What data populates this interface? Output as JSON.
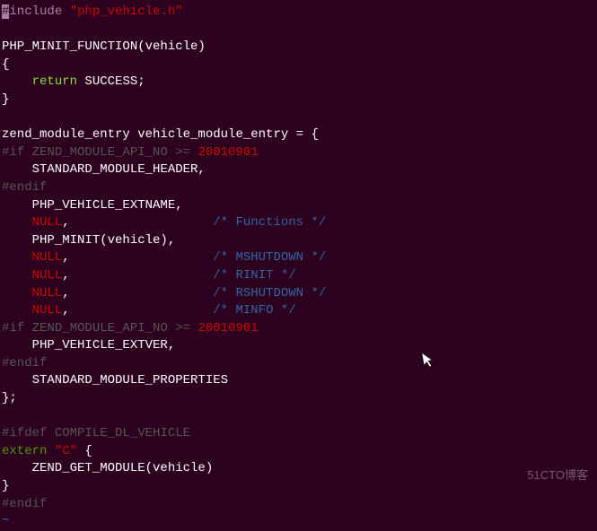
{
  "code": {
    "l1": {
      "hash": "#",
      "include": "include ",
      "file": "\"php_vehicle.h\""
    },
    "l2": "PHP_MINIT_FUNCTION(vehicle)",
    "l3": "{",
    "l4_indent": "    ",
    "l4_return": "return",
    "l4_rest": " SUCCESS;",
    "l5": "}",
    "l6": "zend_module_entry vehicle_module_entry = {",
    "l7_if": "#if",
    "l7_cond": " ZEND_MODULE_API_NO >= ",
    "l7_num": "20010901",
    "l8": "    STANDARD_MODULE_HEADER,",
    "l9": "#endif",
    "l10": "    PHP_VEHICLE_EXTNAME,",
    "l11_indent": "    ",
    "l11_null": "NULL",
    "l11_comma": ",",
    "l11_spaces": "                   ",
    "l11_comment": "/* Functions */",
    "l12": "    PHP_MINIT(vehicle),",
    "l13_null": "NULL",
    "l13_comment": "/* MSHUTDOWN */",
    "l14_null": "NULL",
    "l14_comment": "/* RINIT */",
    "l15_null": "NULL",
    "l15_comment": "/* RSHUTDOWN */",
    "l16_null": "NULL",
    "l16_comment": "/* MINFO */",
    "l17_if": "#if",
    "l17_cond": " ZEND_MODULE_API_NO >= ",
    "l17_num": "20010901",
    "l18": "    PHP_VEHICLE_EXTVER,",
    "l19": "#endif",
    "l20": "    STANDARD_MODULE_PROPERTIES",
    "l21": "};",
    "l22_ifdef": "#ifdef",
    "l22_rest": " COMPILE_DL_VEHICLE",
    "l23_extern": "extern",
    "l23_c": " \"C\"",
    "l23_brace": " {",
    "l24": "    ZEND_GET_MODULE(vehicle)",
    "l25": "}",
    "l26": "#endif",
    "tilde": "~"
  },
  "watermark": "51CTO博客"
}
